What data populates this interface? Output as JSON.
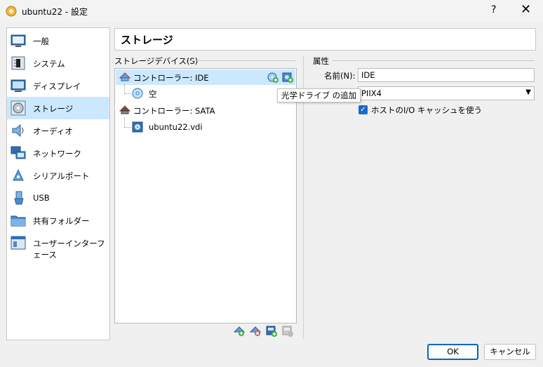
{
  "window": {
    "title": "ubuntu22 - 設定",
    "help_glyph": "?",
    "close_glyph": "✕"
  },
  "sidebar": {
    "items": [
      {
        "label": "一般",
        "icon": "general-icon",
        "selected": false
      },
      {
        "label": "システム",
        "icon": "system-icon",
        "selected": false
      },
      {
        "label": "ディスプレイ",
        "icon": "display-icon",
        "selected": false
      },
      {
        "label": "ストレージ",
        "icon": "storage-icon",
        "selected": true
      },
      {
        "label": "オーディオ",
        "icon": "audio-icon",
        "selected": false
      },
      {
        "label": "ネットワーク",
        "icon": "network-icon",
        "selected": false
      },
      {
        "label": "シリアルポート",
        "icon": "serial-port-icon",
        "selected": false
      },
      {
        "label": "USB",
        "icon": "usb-icon",
        "selected": false
      },
      {
        "label": "共有フォルダー",
        "icon": "shared-folder-icon",
        "selected": false
      },
      {
        "label": "ユーザーインターフェース",
        "icon": "user-interface-icon",
        "selected": false
      }
    ]
  },
  "page": {
    "title": "ストレージ"
  },
  "storage_devices": {
    "label": "ストレージデバイス(S)",
    "tree": [
      {
        "label": "コントローラー: IDE",
        "type": "controller",
        "selected": true
      },
      {
        "label": "空",
        "type": "optical-empty",
        "selected": false
      },
      {
        "label": "コントローラー: SATA",
        "type": "controller",
        "selected": false
      },
      {
        "label": "ubuntu22.vdi",
        "type": "hard-disk",
        "selected": false
      }
    ],
    "tooltip": "光学ドライブ の追加"
  },
  "attributes": {
    "label": "属性",
    "name_label": "名前(N):",
    "name_value": "IDE",
    "type_value": "PIIX4",
    "host_io_cache_label": "ホストのI/O キャッシュを使う",
    "host_io_cache_checked": true
  },
  "buttons": {
    "ok": "OK",
    "cancel": "キャンセル"
  },
  "colors": {
    "selection": "#cce8ff",
    "accent": "#0067c0",
    "checkbox": "#1b6ac9"
  }
}
